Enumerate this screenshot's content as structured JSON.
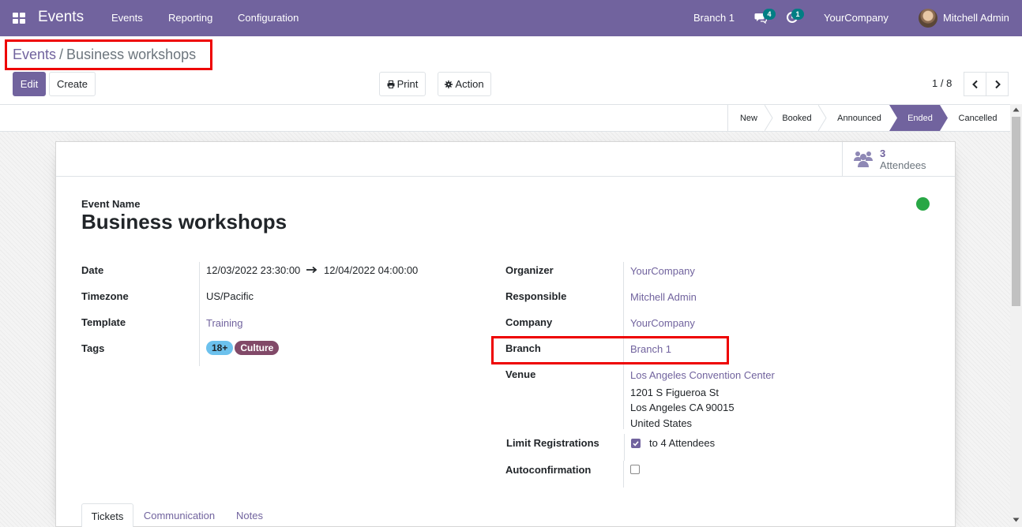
{
  "navbar": {
    "app_name": "Events",
    "menu": [
      "Events",
      "Reporting",
      "Configuration"
    ],
    "branch": "Branch 1",
    "messages_count": "4",
    "activities_count": "1",
    "company": "YourCompany",
    "user": "Mitchell Admin"
  },
  "breadcrumb": {
    "parent": "Events",
    "separator": "/",
    "current": "Business workshops"
  },
  "toolbar": {
    "edit_label": "Edit",
    "create_label": "Create",
    "print_label": "Print",
    "action_label": "Action"
  },
  "pager": {
    "value": "1 / 8"
  },
  "stages": [
    "New",
    "Booked",
    "Announced",
    "Ended",
    "Cancelled"
  ],
  "active_stage": "Ended",
  "stat": {
    "count": "3",
    "label": "Attendees"
  },
  "form": {
    "event_name_label": "Event Name",
    "event_name": "Business workshops",
    "left": {
      "date_label": "Date",
      "date_start": "12/03/2022 23:30:00",
      "date_end": "12/04/2022 04:00:00",
      "timezone_label": "Timezone",
      "timezone": "US/Pacific",
      "template_label": "Template",
      "template": "Training",
      "tags_label": "Tags",
      "tags": [
        {
          "name": "18+",
          "color": "#6cc1ed"
        },
        {
          "name": "Culture",
          "color": "#814968"
        }
      ]
    },
    "right": {
      "organizer_label": "Organizer",
      "organizer": "YourCompany",
      "responsible_label": "Responsible",
      "responsible": "Mitchell Admin",
      "company_label": "Company",
      "company": "YourCompany",
      "branch_label": "Branch",
      "branch": "Branch 1",
      "venue_label": "Venue",
      "venue_name": "Los Angeles Convention Center",
      "venue_street": "1201 S Figueroa St",
      "venue_city": "Los Angeles CA 90015",
      "venue_country": "United States",
      "limit_label": "Limit Registrations",
      "limit_value": "to 4 Attendees",
      "limit_checked": true,
      "autoconfirm_label": "Autoconfirmation",
      "autoconfirm_checked": false
    }
  },
  "tabs": [
    "Tickets",
    "Communication",
    "Notes"
  ],
  "colors": {
    "brand": "#71639e",
    "status_done": "#28a745",
    "highlight": "#ee0000"
  }
}
